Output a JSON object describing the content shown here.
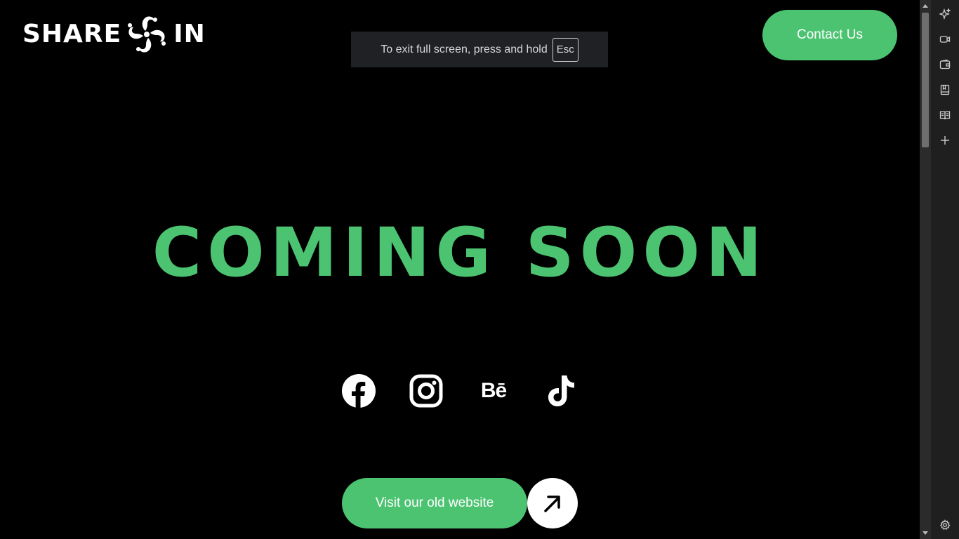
{
  "logo": {
    "text_left": "SHARE",
    "text_right": "IN",
    "mark_icon": "pinwheel-logo-mark"
  },
  "header": {
    "contact_label": "Contact Us"
  },
  "fullscreen_toast": {
    "message": "To exit full screen, press and hold",
    "key": "Esc"
  },
  "main": {
    "headline": "COMING SOON",
    "social": [
      {
        "name": "facebook",
        "icon": "facebook-icon"
      },
      {
        "name": "instagram",
        "icon": "instagram-icon"
      },
      {
        "name": "behance",
        "icon": "behance-icon",
        "text": "Bē"
      },
      {
        "name": "tiktok",
        "icon": "tiktok-icon"
      }
    ],
    "visit_label": "Visit our old website",
    "visit_icon": "arrow-up-right-icon"
  },
  "sidebar": {
    "icons": [
      "copilot-icon",
      "video-icon",
      "wallet-icon",
      "collections-icon",
      "reading-view-icon",
      "add-icon",
      "settings-icon"
    ]
  },
  "colors": {
    "accent": "#4cc371",
    "background": "#000000",
    "text": "#ffffff",
    "toast_bg": "#202124"
  }
}
